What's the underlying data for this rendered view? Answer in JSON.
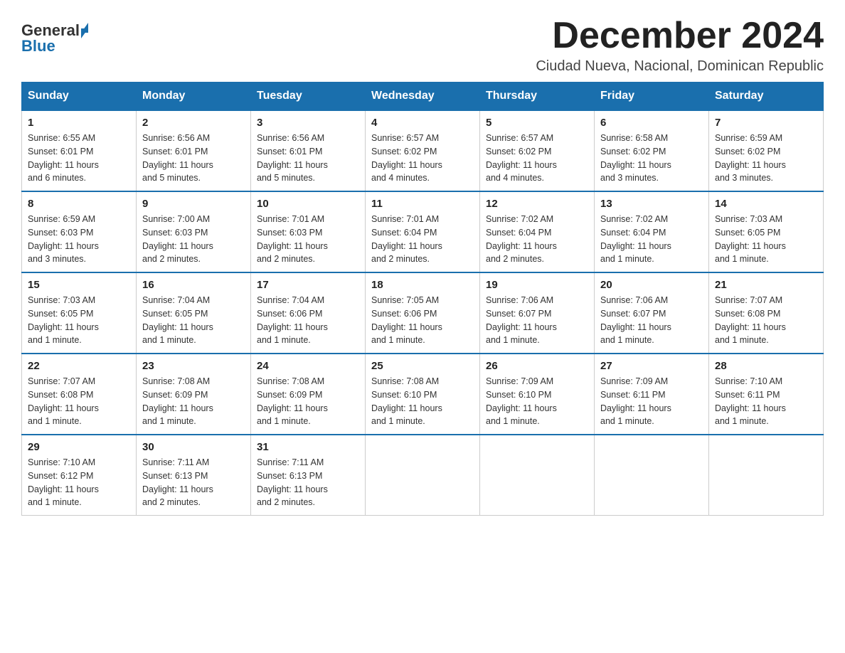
{
  "logo": {
    "text_general": "General",
    "text_blue": "Blue"
  },
  "title": "December 2024",
  "subtitle": "Ciudad Nueva, Nacional, Dominican Republic",
  "days_of_week": [
    "Sunday",
    "Monday",
    "Tuesday",
    "Wednesday",
    "Thursday",
    "Friday",
    "Saturday"
  ],
  "weeks": [
    [
      {
        "date": "1",
        "sunrise": "6:55 AM",
        "sunset": "6:01 PM",
        "daylight": "11 hours and 6 minutes."
      },
      {
        "date": "2",
        "sunrise": "6:56 AM",
        "sunset": "6:01 PM",
        "daylight": "11 hours and 5 minutes."
      },
      {
        "date": "3",
        "sunrise": "6:56 AM",
        "sunset": "6:01 PM",
        "daylight": "11 hours and 5 minutes."
      },
      {
        "date": "4",
        "sunrise": "6:57 AM",
        "sunset": "6:02 PM",
        "daylight": "11 hours and 4 minutes."
      },
      {
        "date": "5",
        "sunrise": "6:57 AM",
        "sunset": "6:02 PM",
        "daylight": "11 hours and 4 minutes."
      },
      {
        "date": "6",
        "sunrise": "6:58 AM",
        "sunset": "6:02 PM",
        "daylight": "11 hours and 3 minutes."
      },
      {
        "date": "7",
        "sunrise": "6:59 AM",
        "sunset": "6:02 PM",
        "daylight": "11 hours and 3 minutes."
      }
    ],
    [
      {
        "date": "8",
        "sunrise": "6:59 AM",
        "sunset": "6:03 PM",
        "daylight": "11 hours and 3 minutes."
      },
      {
        "date": "9",
        "sunrise": "7:00 AM",
        "sunset": "6:03 PM",
        "daylight": "11 hours and 2 minutes."
      },
      {
        "date": "10",
        "sunrise": "7:01 AM",
        "sunset": "6:03 PM",
        "daylight": "11 hours and 2 minutes."
      },
      {
        "date": "11",
        "sunrise": "7:01 AM",
        "sunset": "6:04 PM",
        "daylight": "11 hours and 2 minutes."
      },
      {
        "date": "12",
        "sunrise": "7:02 AM",
        "sunset": "6:04 PM",
        "daylight": "11 hours and 2 minutes."
      },
      {
        "date": "13",
        "sunrise": "7:02 AM",
        "sunset": "6:04 PM",
        "daylight": "11 hours and 1 minute."
      },
      {
        "date": "14",
        "sunrise": "7:03 AM",
        "sunset": "6:05 PM",
        "daylight": "11 hours and 1 minute."
      }
    ],
    [
      {
        "date": "15",
        "sunrise": "7:03 AM",
        "sunset": "6:05 PM",
        "daylight": "11 hours and 1 minute."
      },
      {
        "date": "16",
        "sunrise": "7:04 AM",
        "sunset": "6:05 PM",
        "daylight": "11 hours and 1 minute."
      },
      {
        "date": "17",
        "sunrise": "7:04 AM",
        "sunset": "6:06 PM",
        "daylight": "11 hours and 1 minute."
      },
      {
        "date": "18",
        "sunrise": "7:05 AM",
        "sunset": "6:06 PM",
        "daylight": "11 hours and 1 minute."
      },
      {
        "date": "19",
        "sunrise": "7:06 AM",
        "sunset": "6:07 PM",
        "daylight": "11 hours and 1 minute."
      },
      {
        "date": "20",
        "sunrise": "7:06 AM",
        "sunset": "6:07 PM",
        "daylight": "11 hours and 1 minute."
      },
      {
        "date": "21",
        "sunrise": "7:07 AM",
        "sunset": "6:08 PM",
        "daylight": "11 hours and 1 minute."
      }
    ],
    [
      {
        "date": "22",
        "sunrise": "7:07 AM",
        "sunset": "6:08 PM",
        "daylight": "11 hours and 1 minute."
      },
      {
        "date": "23",
        "sunrise": "7:08 AM",
        "sunset": "6:09 PM",
        "daylight": "11 hours and 1 minute."
      },
      {
        "date": "24",
        "sunrise": "7:08 AM",
        "sunset": "6:09 PM",
        "daylight": "11 hours and 1 minute."
      },
      {
        "date": "25",
        "sunrise": "7:08 AM",
        "sunset": "6:10 PM",
        "daylight": "11 hours and 1 minute."
      },
      {
        "date": "26",
        "sunrise": "7:09 AM",
        "sunset": "6:10 PM",
        "daylight": "11 hours and 1 minute."
      },
      {
        "date": "27",
        "sunrise": "7:09 AM",
        "sunset": "6:11 PM",
        "daylight": "11 hours and 1 minute."
      },
      {
        "date": "28",
        "sunrise": "7:10 AM",
        "sunset": "6:11 PM",
        "daylight": "11 hours and 1 minute."
      }
    ],
    [
      {
        "date": "29",
        "sunrise": "7:10 AM",
        "sunset": "6:12 PM",
        "daylight": "11 hours and 1 minute."
      },
      {
        "date": "30",
        "sunrise": "7:11 AM",
        "sunset": "6:13 PM",
        "daylight": "11 hours and 2 minutes."
      },
      {
        "date": "31",
        "sunrise": "7:11 AM",
        "sunset": "6:13 PM",
        "daylight": "11 hours and 2 minutes."
      },
      null,
      null,
      null,
      null
    ]
  ],
  "labels": {
    "sunrise_label": "Sunrise:",
    "sunset_label": "Sunset:",
    "daylight_label": "Daylight:"
  }
}
